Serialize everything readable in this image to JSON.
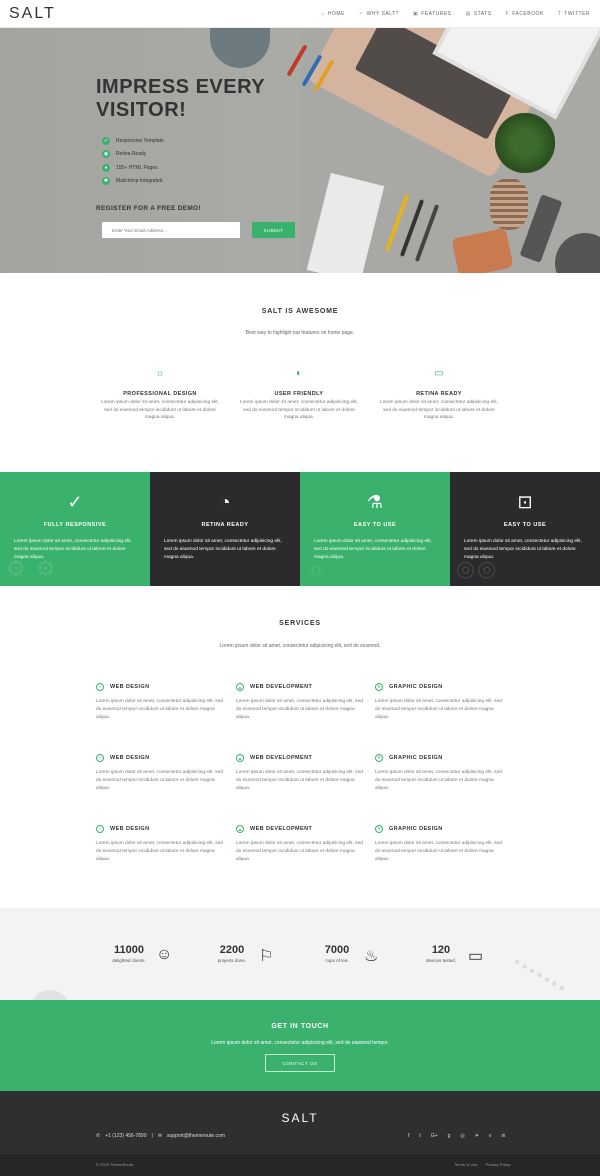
{
  "nav": {
    "logo": "SALT",
    "items": [
      {
        "label": "HOME",
        "icon": "home-icon"
      },
      {
        "label": "WHY SALT?",
        "icon": "check-icon"
      },
      {
        "label": "FEATURES",
        "icon": "gift-icon"
      },
      {
        "label": "STATS",
        "icon": "stats-icon"
      },
      {
        "label": "FACEBOOK",
        "icon": "facebook-icon"
      },
      {
        "label": "TWITTER",
        "icon": "twitter-icon"
      }
    ]
  },
  "hero": {
    "title": "IMPRESS EVERY VISITOR!",
    "list": [
      "Responsive Template",
      "Retina Ready",
      "155+ HTML Pages",
      "Mailchimp Integrated"
    ],
    "register": "REGISTER FOR A FREE DEMO!",
    "email_placeholder": "Enter Your Email Address...",
    "submit": "SUBMIT"
  },
  "awesome": {
    "title": "SALT IS AWESOME",
    "subtitle": "Best way to highlight top features on home page.",
    "features": [
      {
        "title": "PROFESSIONAL DESIGN",
        "text": "Lorem ipsum dolor sit amet, consectetur adipisicing elit, sed do eiusmod tempor incididunt ut labore et dolore magna aliqua.",
        "icon": "lightbulb-icon"
      },
      {
        "title": "USER FRIENDLY",
        "text": "Lorem ipsum dolor sit amet, consectetur adipisicing elit, sed do eiusmod tempor incididunt ut labore et dolore magna aliqua.",
        "icon": "mouse-icon"
      },
      {
        "title": "RETINA READY",
        "text": "Lorem ipsum dolor sit amet, consectetur adipisicing elit, sed do eiusmod tempor incididunt ut labore et dolore magna aliqua.",
        "icon": "monitor-icon"
      }
    ]
  },
  "band": [
    {
      "title": "FULLY RESPONSIVE",
      "text": "Lorem ipsum dolor sit amet, consectetur adipisicing elit, sed do eiusmod tempor incididunt ut labore et dolore magna aliqua.",
      "icon": "check-circle-icon",
      "bg": "#3bb16e"
    },
    {
      "title": "RETINA READY",
      "text": "Lorem ipsum dolor sit amet, consectetur adipisicing elit, sed do eiusmod tempor incididunt ut labore et dolore magna aliqua.",
      "icon": "gauge-icon",
      "bg": "#2b2b2d"
    },
    {
      "title": "EASY TO USE",
      "text": "Lorem ipsum dolor sit amet, consectetur adipisicing elit, sed do eiusmod tempor incididunt ut labore et dolore magna aliqua.",
      "icon": "flask-icon",
      "bg": "#3bb16e"
    },
    {
      "title": "EASY TO USE",
      "text": "Lorem ipsum dolor sit amet, consectetur adipisicing elit, sed do eiusmod tempor incididunt ut labore et dolore magna aliqua.",
      "icon": "lock-icon",
      "bg": "#2b2b2d"
    }
  ],
  "services": {
    "title": "SERVICES",
    "subtitle": "Lorem ipsum dolor sit amet, consectetur adipisicing elit, sed do eiusmod.",
    "items": [
      {
        "title": "WEB DESIGN",
        "icon": "check-circle-icon",
        "text": "Lorem ipsum dolor sit amet, consectetur adipisicing elit, sed do eiusmod tempor incididunt ut labore et dolore magna aliqua."
      },
      {
        "title": "WEB DEVELOPMENT",
        "icon": "image-icon",
        "text": "Lorem ipsum dolor sit amet, consectetur adipisicing elit, sed do eiusmod tempor incididunt ut labore et dolore magna aliqua."
      },
      {
        "title": "GRAPHIC DESIGN",
        "icon": "aperture-icon",
        "text": "Lorem ipsum dolor sit amet, consectetur adipisicing elit, sed do eiusmod tempor incididunt ut labore et dolore magna aliqua."
      },
      {
        "title": "WEB DESIGN",
        "icon": "check-circle-icon",
        "text": "Lorem ipsum dolor sit amet, consectetur adipisicing elit, sed do eiusmod tempor incididunt ut labore et dolore magna aliqua."
      },
      {
        "title": "WEB DEVELOPMENT",
        "icon": "image-icon",
        "text": "Lorem ipsum dolor sit amet, consectetur adipisicing elit, sed do eiusmod tempor incididunt ut labore et dolore magna aliqua."
      },
      {
        "title": "GRAPHIC DESIGN",
        "icon": "aperture-icon",
        "text": "Lorem ipsum dolor sit amet, consectetur adipisicing elit, sed do eiusmod tempor incididunt ut labore et dolore magna aliqua."
      },
      {
        "title": "WEB DESIGN",
        "icon": "check-circle-icon",
        "text": "Lorem ipsum dolor sit amet, consectetur adipisicing elit, sed do eiusmod tempor incididunt ut labore et dolore magna aliqua."
      },
      {
        "title": "WEB DEVELOPMENT",
        "icon": "image-icon",
        "text": "Lorem ipsum dolor sit amet, consectetur adipisicing elit, sed do eiusmod tempor incididunt ut labore et dolore magna aliqua."
      },
      {
        "title": "GRAPHIC DESIGN",
        "icon": "aperture-icon",
        "text": "Lorem ipsum dolor sit amet, consectetur adipisicing elit, sed do eiusmod tempor incididunt ut labore et dolore magna aliqua."
      }
    ]
  },
  "stats": [
    {
      "num": "11000",
      "label": "delighted clients.",
      "icon": "smile-icon"
    },
    {
      "num": "2200",
      "label": "projects done.",
      "icon": "flag-icon"
    },
    {
      "num": "7000",
      "label": "cups of tea.",
      "icon": "flame-icon"
    },
    {
      "num": "120",
      "label": "devices tested.",
      "icon": "tablet-icon"
    }
  ],
  "contact": {
    "title": "GET IN TOUCH",
    "text": "Lorem ipsum dolor sit amet, consectetur adipisicing elit, sed do eiusmod tempor.",
    "button": "CONTACT US"
  },
  "footer": {
    "logo": "SALT",
    "phone": "+1 (123) 456-7890",
    "separator": "|",
    "email": "support@themeroute.com",
    "socials": [
      "f",
      "t",
      "G+",
      "g",
      "◎",
      "✈",
      "v",
      "in"
    ],
    "copyright": "© 2016 ThemeRoute.",
    "links": [
      "Terms of Use",
      "Privacy Policy"
    ]
  },
  "colors": {
    "accent": "#3bb16e",
    "dark": "#2b2b2d"
  }
}
